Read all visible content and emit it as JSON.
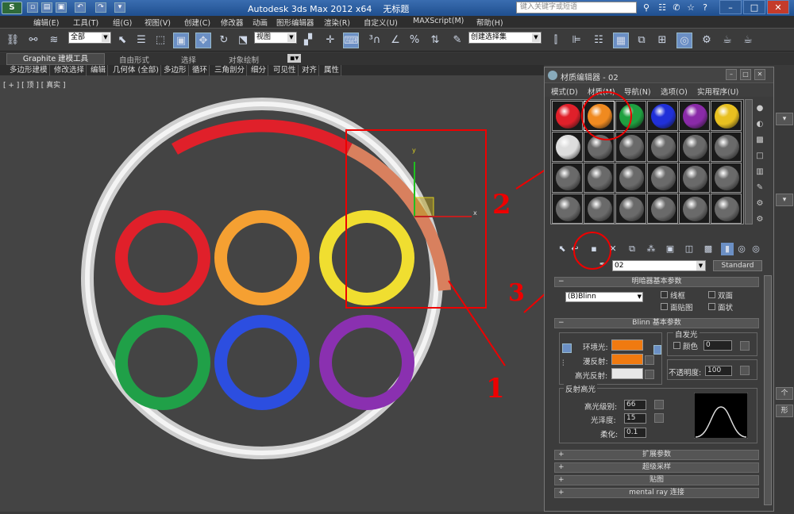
{
  "titlebar": {
    "app_title": "Autodesk 3ds Max  2012 x64",
    "doc_title": "无标题",
    "search_placeholder": "键入关键字或短语"
  },
  "menubar": {
    "items": [
      "编辑(E)",
      "工具(T)",
      "组(G)",
      "视图(V)",
      "创建(C)",
      "修改器",
      "动画",
      "图形编辑器",
      "渲染(R)",
      "自定义(U)",
      "MAXScript(M)",
      "帮助(H)"
    ]
  },
  "toolbar": {
    "selection_filter": "全部",
    "reference_coord": "视图",
    "named_selection_placeholder": "创建选择集"
  },
  "ribbon": {
    "tabs": [
      "Graphite 建模工具",
      "自由形式",
      "选择",
      "对象绘制"
    ]
  },
  "subbar": {
    "items": [
      "多边形建模",
      "修改选择",
      "编辑",
      "几何体 (全部)",
      "多边形",
      "循环",
      "三角剖分",
      "细分",
      "可见性",
      "对齐",
      "属性"
    ]
  },
  "viewport": {
    "label": "[ + ] [ 顶 ] [ 真实 ]"
  },
  "material_editor": {
    "title": "材质编辑器 - 02",
    "menu": [
      "模式(D)",
      "材质(M)",
      "导航(N)",
      "选项(O)",
      "实用程序(U)"
    ],
    "slot_colors": [
      "#e0202a",
      "#f08a20",
      "#1fa040",
      "#2030d8",
      "#8a2aa8",
      "#e8c020",
      "#dddddd",
      "#6a6a6a",
      "#6a6a6a",
      "#6a6a6a",
      "#6a6a6a",
      "#6a6a6a",
      "#6a6a6a",
      "#6a6a6a",
      "#6a6a6a",
      "#6a6a6a",
      "#6a6a6a",
      "#6a6a6a",
      "#6a6a6a",
      "#6a6a6a",
      "#6a6a6a",
      "#6a6a6a",
      "#6a6a6a",
      "#6a6a6a"
    ],
    "material_name": "02",
    "material_type": "Standard",
    "shader_basic": {
      "header": "明暗器基本参数",
      "shader": "(B)Blinn",
      "wire": "线框",
      "two_sided": "双面",
      "face_map": "面贴图",
      "faceted": "面状"
    },
    "blinn_basic": {
      "header": "Blinn 基本参数",
      "self_illum": "自发光",
      "color_label": "颜色",
      "color_value": "0",
      "ambient": "环境光:",
      "diffuse": "漫反射:",
      "specular": "高光反射:",
      "opacity_label": "不透明度:",
      "opacity_value": "100",
      "ambient_color": "#f07a10",
      "diffuse_color": "#f07a10",
      "specular_color": "#e8e8e8"
    },
    "specular_highlights": {
      "header": "反射高光",
      "level_label": "高光级别:",
      "level_value": "66",
      "gloss_label": "光泽度:",
      "gloss_value": "15",
      "soften_label": "柔化:",
      "soften_value": "0.1"
    },
    "rollouts": [
      "扩展参数",
      "超级采样",
      "贴图",
      "mental ray 连接"
    ]
  },
  "annotations": {
    "one": "1",
    "two": "2",
    "three": "3"
  },
  "rightedge": {
    "label1": "个",
    "label2": "形"
  }
}
